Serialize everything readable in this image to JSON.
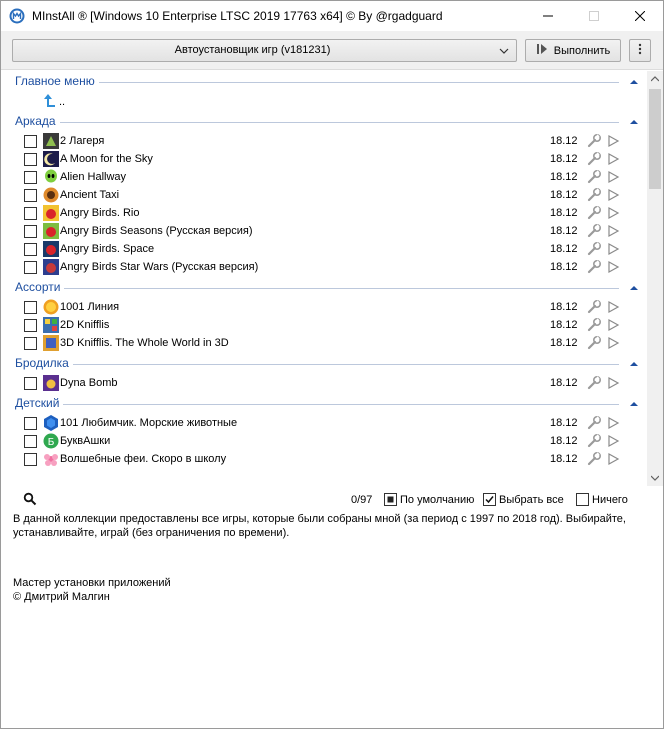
{
  "window": {
    "title": "MInstAll ® [Windows 10 Enterprise LTSC 2019 17763 x64] © By @rgadguard"
  },
  "toolbar": {
    "combo_value": "Автоустановщик игр (v181231)",
    "run_label": "Выполнить"
  },
  "main_menu": {
    "header": "Главное меню",
    "up_label": ".."
  },
  "groups": [
    {
      "name": "Аркада",
      "items": [
        {
          "name": "2 Лагеря",
          "version": "18.12"
        },
        {
          "name": "A Moon for the Sky",
          "version": "18.12"
        },
        {
          "name": "Alien Hallway",
          "version": "18.12"
        },
        {
          "name": "Ancient Taxi",
          "version": "18.12"
        },
        {
          "name": "Angry Birds. Rio",
          "version": "18.12"
        },
        {
          "name": "Angry Birds Seasons (Русская версия)",
          "version": "18.12"
        },
        {
          "name": "Angry Birds. Space",
          "version": "18.12"
        },
        {
          "name": "Angry Birds Star Wars (Русская версия)",
          "version": "18.12"
        }
      ]
    },
    {
      "name": "Ассорти",
      "items": [
        {
          "name": "1001 Линия",
          "version": "18.12"
        },
        {
          "name": "2D Knifflis",
          "version": "18.12"
        },
        {
          "name": "3D Knifflis. The Whole World in 3D",
          "version": "18.12"
        }
      ]
    },
    {
      "name": "Бродилка",
      "items": [
        {
          "name": "Dyna Bomb",
          "version": "18.12"
        }
      ]
    },
    {
      "name": "Детский",
      "items": [
        {
          "name": "101 Любимчик. Морские животные",
          "version": "18.12"
        },
        {
          "name": "БуквАшки",
          "version": "18.12"
        },
        {
          "name": "Волшебные феи. Скоро в школу",
          "version": "18.12"
        }
      ]
    }
  ],
  "bottom": {
    "count": "0/97",
    "default_label": "По умолчанию",
    "select_all_label": "Выбрать все",
    "none_label": "Ничего"
  },
  "description": "В данной коллекции предоставлены все игры, которые были собраны мной (за период с 1997 по 2018 год). Выбирайте, устанавливайте, играй (без ограничения по времени).",
  "footer": {
    "line1": "Мастер установки приложений",
    "line2": "© Дмитрий Малгин"
  },
  "icons": {
    "app": "app-logo-icon",
    "minimize": "minimize-icon",
    "maximize": "maximize-icon",
    "close": "close-icon",
    "dropdown": "chevron-down-icon",
    "run": "run-icon",
    "menu": "more-vertical-icon",
    "up": "up-arrow-icon",
    "wrench": "wrench-icon",
    "play": "play-icon",
    "collapse": "chevron-up-icon",
    "search": "search-icon"
  },
  "colors": {
    "group_header": "#1e4fa0",
    "app_icon": "#2a6ebd"
  }
}
